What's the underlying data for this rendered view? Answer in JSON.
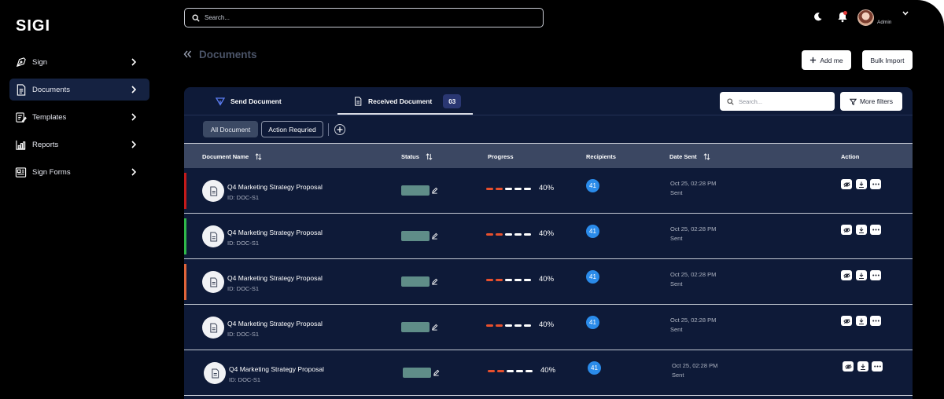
{
  "app": {
    "logo": "SIGI"
  },
  "sidebar": {
    "items": [
      {
        "label": "Sign",
        "icon": "pen-nib-icon",
        "active": false
      },
      {
        "label": "Documents",
        "icon": "document-icon",
        "active": true
      },
      {
        "label": "Templates",
        "icon": "template-icon",
        "active": false
      },
      {
        "label": "Reports",
        "icon": "chart-icon",
        "active": false
      },
      {
        "label": "Sign Forms",
        "icon": "form-icon",
        "active": false
      }
    ]
  },
  "topbar": {
    "search_placeholder": "Search...",
    "user_name": "Admin",
    "notification_dot_color": "#e23b3b"
  },
  "header": {
    "title": "Documents",
    "add_button": "Add me",
    "bulk_button": "Bulk Import"
  },
  "card": {
    "tabs": [
      {
        "label": "Send Document",
        "icon": "send-icon"
      },
      {
        "label": "Received Document",
        "icon": "document-icon",
        "count": "03"
      }
    ],
    "search_placeholder": "Search...",
    "filters_button": "More filters",
    "chips": {
      "all": "All Document",
      "action": "Action Requried"
    }
  },
  "table": {
    "columns": {
      "name": "Document Name",
      "status": "Status",
      "progress": "Progress",
      "recipients": "Recipients",
      "date": "Date Sent",
      "action": "Action"
    },
    "rows": [
      {
        "name": "Q4 Marketing Strategy Proposal",
        "id": "ID: DOC-S1",
        "progress_label": "40%",
        "progress": 0.4,
        "recipients": "41",
        "date": "Oct 25, 02:28 PM",
        "state": "Sent",
        "stripe": "#c41a1a"
      },
      {
        "name": "Q4 Marketing Strategy Proposal",
        "id": "ID: DOC-S1",
        "progress_label": "40%",
        "progress": 0.4,
        "recipients": "41",
        "date": "Oct 25, 02:28 PM",
        "state": "Sent",
        "stripe": "#2fb84a"
      },
      {
        "name": "Q4 Marketing Strategy Proposal",
        "id": "ID: DOC-S1",
        "progress_label": "40%",
        "progress": 0.4,
        "recipients": "41",
        "date": "Oct 25, 02:28 PM",
        "state": "Sent",
        "stripe": "#e0643a"
      },
      {
        "name": "Q4 Marketing Strategy Proposal",
        "id": "ID: DOC-S1",
        "progress_label": "40%",
        "progress": 0.4,
        "recipients": "41",
        "date": "Oct 25, 02:28 PM",
        "state": "Sent",
        "stripe": ""
      },
      {
        "name": "Q4 Marketing Strategy Proposal",
        "id": "ID: DOC-S1",
        "progress_label": "40%",
        "progress": 0.4,
        "recipients": "41",
        "date": "Oct 25, 02:28 PM",
        "state": "Sent",
        "stripe": ""
      }
    ]
  },
  "colors": {
    "progress_done": "#e8502d",
    "progress_todo": "#ffffff",
    "recipient_badge": "#2a8bea",
    "card_bg": "#0e1a38"
  }
}
